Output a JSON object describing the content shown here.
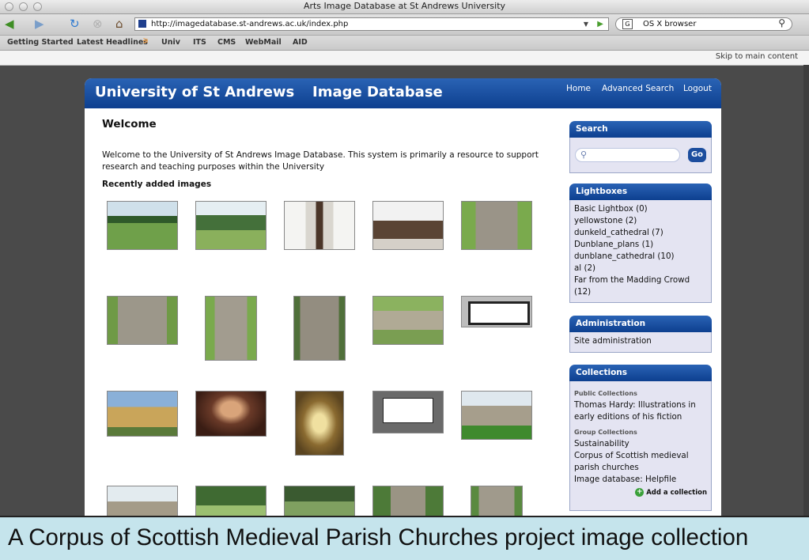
{
  "window": {
    "title": "Arts Image Database at St Andrews University"
  },
  "toolbar": {
    "url": "http://imagedatabase.st-andrews.ac.uk/index.php",
    "search_engine_text": "OS X browser"
  },
  "bookmarks": [
    "Getting Started",
    "Latest Headlines",
    "Univ",
    "ITS",
    "CMS",
    "WebMail",
    "AID"
  ],
  "skip_link": "Skip to main content",
  "header": {
    "brand": "University of St Andrews",
    "product": "Image Database",
    "nav": [
      "Home",
      "Advanced Search",
      "Logout"
    ]
  },
  "main": {
    "heading": "Welcome",
    "intro": "Welcome to the University of St Andrews Image Database. This system is primarily a resource to support research and teaching purposes within the University",
    "recent_heading": "Recently added images"
  },
  "sidebar": {
    "search": {
      "title": "Search",
      "button": "Go"
    },
    "lightboxes": {
      "title": "Lightboxes",
      "items": [
        "Basic Lightbox (0)",
        "yellowstone (2)",
        "dunkeld_cathedral (7)",
        "Dunblane_plans (1)",
        "dunblane_cathedral (10)",
        "al (2)",
        "Far from the Madding Crowd (12)"
      ]
    },
    "administration": {
      "title": "Administration",
      "items": [
        "Site administration"
      ]
    },
    "collections": {
      "title": "Collections",
      "public_label": "Public Collections",
      "public_items": [
        "Thomas Hardy: Illustrations in early editions of his fiction"
      ],
      "group_label": "Group Collections",
      "group_items": [
        "Sustainability",
        "Corpus of Scottish medieval parish churches",
        "Image database: Helpfile"
      ],
      "add_label": "Add a collection"
    }
  },
  "caption": "A Corpus of Scottish Medieval Parish Churches project image collection"
}
